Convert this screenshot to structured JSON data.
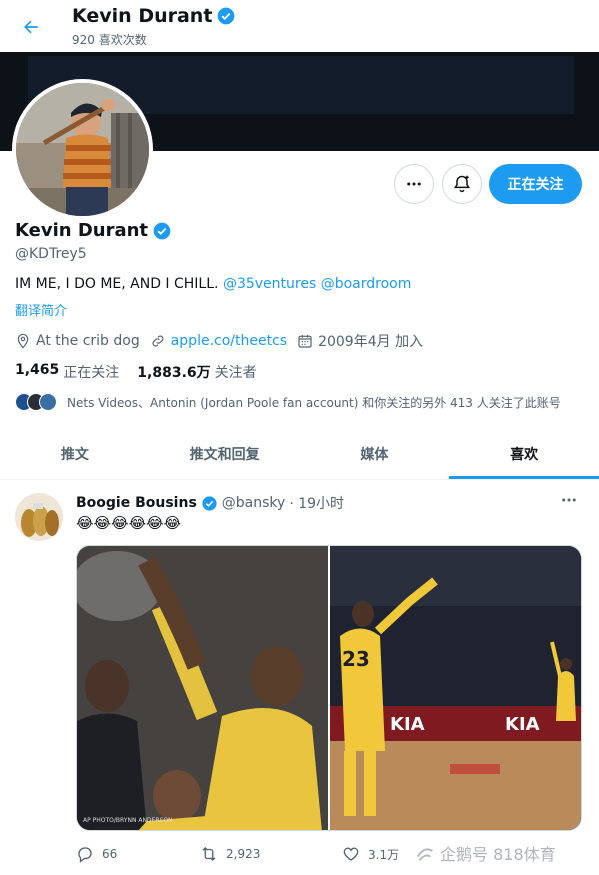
{
  "header": {
    "name": "Kevin Durant",
    "likes_count": "920 喜欢次数"
  },
  "profile": {
    "name": "Kevin Durant",
    "handle": "@KDTrey5",
    "bio_text": "IM ME, I DO ME, AND I CHILL.",
    "bio_links": [
      "@35ventures",
      "@boardroom"
    ],
    "translate_label": "翻译简介",
    "location": "At the crib dog",
    "website": "apple.co/theetcs",
    "joined": "2009年4月 加入",
    "following_count": "1,465",
    "following_label": "正在关注",
    "followers_count": "1,883.6万",
    "followers_label": "关注者",
    "followed_by_text": "Nets Videos、Antonin (Jordan Poole fan account) 和你关注的另外 413 人关注了此账号",
    "follow_button": "正在关注"
  },
  "tabs": [
    "推文",
    "推文和回复",
    "媒体",
    "喜欢"
  ],
  "active_tab": "喜欢",
  "tweet": {
    "author": "Boogie Bousins",
    "handle": "@bansky",
    "time": "· 19小时",
    "text": "😂😂😂😂😂😂",
    "photo_credit": "AP PHOTO/BRYNN ANDERSON",
    "reply_count": "66",
    "retweet_count": "2,923",
    "like_count": "3.1万"
  },
  "watermark": "企鹅号 818体育",
  "colors": {
    "accent": "#1d9bf0",
    "text_primary": "#0f1419",
    "text_secondary": "#536471",
    "border": "#cfd9de"
  }
}
